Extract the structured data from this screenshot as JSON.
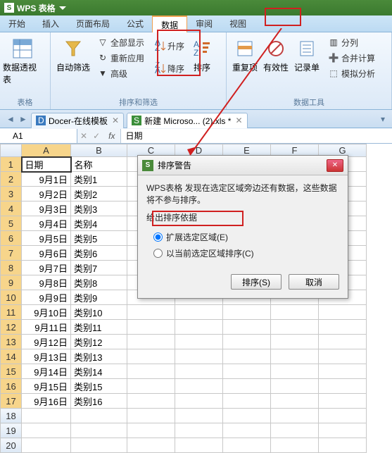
{
  "title": "WPS 表格",
  "menu": [
    "开始",
    "插入",
    "页面布局",
    "公式",
    "数据",
    "审阅",
    "视图"
  ],
  "menu_active": 4,
  "ribbon": {
    "g1": {
      "pivotTable": "数据透视表",
      "label": "表格"
    },
    "g2": {
      "autoFilter": "自动筛选",
      "showAll": "全部显示",
      "reapply": "重新应用",
      "advanced": "高级",
      "asc": "升序",
      "desc": "降序",
      "sort": "排序",
      "label": "排序和筛选"
    },
    "g3": {
      "dup": "重复项",
      "valid": "有效性",
      "form": "记录单",
      "split": "分列",
      "subtotal": "合并计算",
      "whatif": "模拟分析",
      "label": "数据工具"
    }
  },
  "doctabs": [
    {
      "label": "Docer-在线模板"
    },
    {
      "label": "新建 Microso... (2).xls *"
    }
  ],
  "namebox": "A1",
  "fxvalue": "日期",
  "cols": [
    "A",
    "B",
    "C",
    "D",
    "E",
    "F",
    "G"
  ],
  "rows": [
    {
      "n": 1,
      "a": "日期",
      "b": "名称"
    },
    {
      "n": 2,
      "a": "9月1日",
      "b": "类别1"
    },
    {
      "n": 3,
      "a": "9月2日",
      "b": "类别2"
    },
    {
      "n": 4,
      "a": "9月3日",
      "b": "类别3"
    },
    {
      "n": 5,
      "a": "9月4日",
      "b": "类别4"
    },
    {
      "n": 6,
      "a": "9月5日",
      "b": "类别5"
    },
    {
      "n": 7,
      "a": "9月6日",
      "b": "类别6"
    },
    {
      "n": 8,
      "a": "9月7日",
      "b": "类别7"
    },
    {
      "n": 9,
      "a": "9月8日",
      "b": "类别8"
    },
    {
      "n": 10,
      "a": "9月9日",
      "b": "类别9"
    },
    {
      "n": 11,
      "a": "9月10日",
      "b": "类别10"
    },
    {
      "n": 12,
      "a": "9月11日",
      "b": "类别11"
    },
    {
      "n": 13,
      "a": "9月12日",
      "b": "类别12"
    },
    {
      "n": 14,
      "a": "9月13日",
      "b": "类别13"
    },
    {
      "n": 15,
      "a": "9月14日",
      "b": "类别14"
    },
    {
      "n": 16,
      "a": "9月15日",
      "b": "类别15"
    },
    {
      "n": 17,
      "a": "9月16日",
      "b": "类别16"
    },
    {
      "n": 18,
      "a": "",
      "b": ""
    },
    {
      "n": 19,
      "a": "",
      "b": ""
    },
    {
      "n": 20,
      "a": "",
      "b": ""
    }
  ],
  "dialog": {
    "title": "排序警告",
    "msg": "WPS表格 发现在选定区域旁边还有数据，这些数据将不参与排序。",
    "legend": "给出排序依据",
    "opt1": "扩展选定区域(E)",
    "opt2": "以当前选定区域排序(C)",
    "ok": "排序(S)",
    "cancel": "取消"
  }
}
